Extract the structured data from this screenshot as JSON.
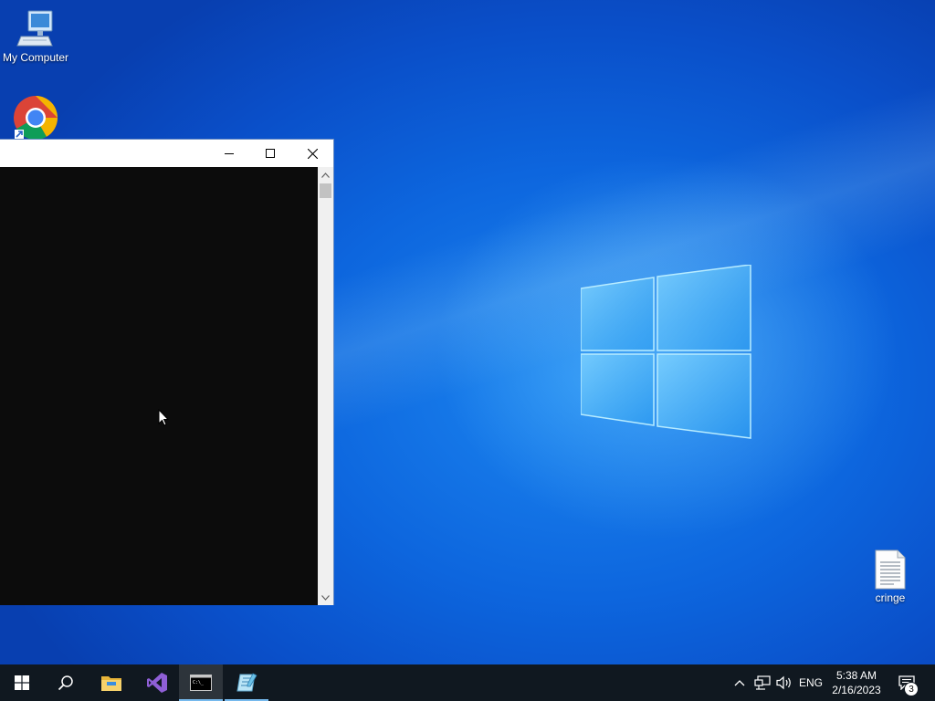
{
  "desktop": {
    "icons": [
      {
        "label": "My Computer",
        "icon": "computer-icon"
      },
      {
        "label": "",
        "icon": "chrome-icon"
      },
      {
        "label": "cringe",
        "icon": "text-file-icon"
      }
    ]
  },
  "console_window": {
    "title": "",
    "controls": {
      "minimize": "minimize-icon",
      "maximize": "maximize-icon",
      "close": "close-icon"
    }
  },
  "taskbar": {
    "apps": [
      {
        "icon": "start-icon"
      },
      {
        "icon": "search-icon"
      },
      {
        "icon": "file-explorer-icon"
      },
      {
        "icon": "visual-studio-icon"
      },
      {
        "icon": "command-prompt-icon",
        "state": "active"
      },
      {
        "icon": "notepad-icon",
        "state": "running"
      }
    ],
    "tray": {
      "language": "ENG",
      "time": "5:38 AM",
      "date": "2/16/2023",
      "notification_count": "3"
    }
  },
  "colors": {
    "taskbar": "#101820",
    "desktop": "#0a5fd8",
    "console": "#0c0c0c",
    "running_indicator": "#76b9ed"
  }
}
